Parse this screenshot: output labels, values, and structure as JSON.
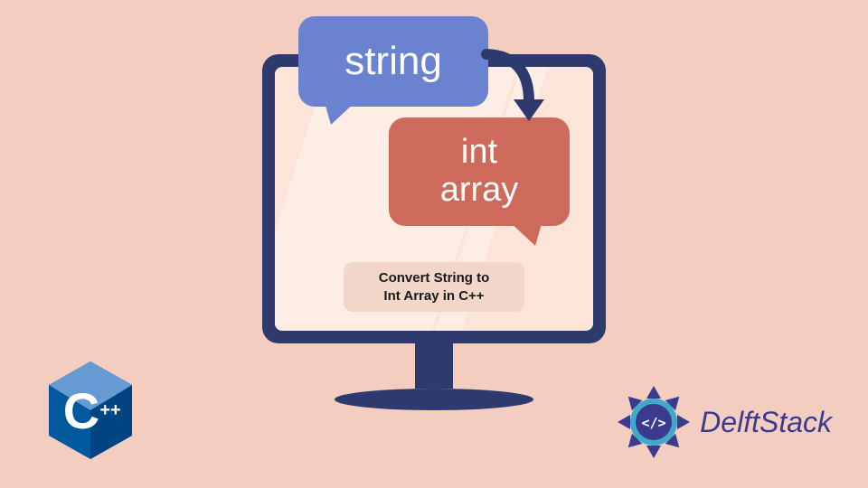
{
  "bubble_blue": "string",
  "bubble_red_line1": "int",
  "bubble_red_line2": "array",
  "caption_line1": "Convert String to",
  "caption_line2": "Int Array in C++",
  "cpp_logo_main": "C",
  "cpp_logo_plus": "++",
  "brand": "DelftStack",
  "brand_code": "</>"
}
